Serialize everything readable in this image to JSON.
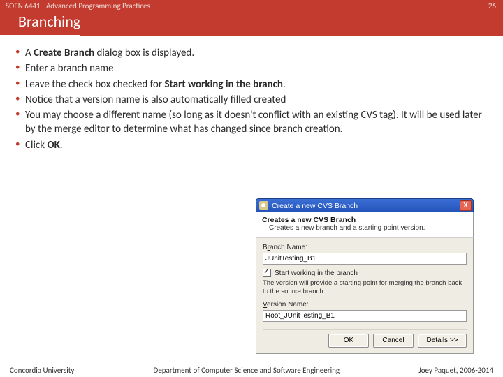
{
  "header": {
    "course": "SOEN 6441 - Advanced Programming Practices",
    "slide_number": "26",
    "title": "Branching"
  },
  "bullets": {
    "b1a": "A ",
    "b1b": "Create Branch",
    "b1c": " dialog box is displayed.",
    "b2": "Enter a branch name",
    "b3a": "Leave the check box checked for ",
    "b3b": "Start working in the branch",
    "b3c": ".",
    "b4": "Notice that a version name is also automatically filled created",
    "b5": "You may choose a different name (so long as it doesn't conflict with an existing CVS tag). It will be used later by the merge editor to determine what has changed since branch creation.",
    "b6a": "Click ",
    "b6b": "OK",
    "b6c": "."
  },
  "dialog": {
    "title": "Create a new CVS Branch",
    "head_title": "Creates a new CVS Branch",
    "head_sub": "Creates a new branch and a starting point version.",
    "branch_label_pre": "B",
    "branch_label_u": "r",
    "branch_label_post": "anch Name:",
    "branch_value": "JUnitTesting_B1",
    "check_label": "Start working in the branch",
    "note": "The version will provide a starting point for merging the branch back to the source branch.",
    "version_label_u": "V",
    "version_label_post": "ersion Name:",
    "version_value": "Root_JUnitTesting_B1",
    "ok": "OK",
    "cancel": "Cancel",
    "details": "Details >>",
    "close": "X"
  },
  "footer": {
    "left": "Concordia University",
    "center": "Department of Computer Science and Software Engineering",
    "right": "Joey Paquet, 2006-2014"
  }
}
